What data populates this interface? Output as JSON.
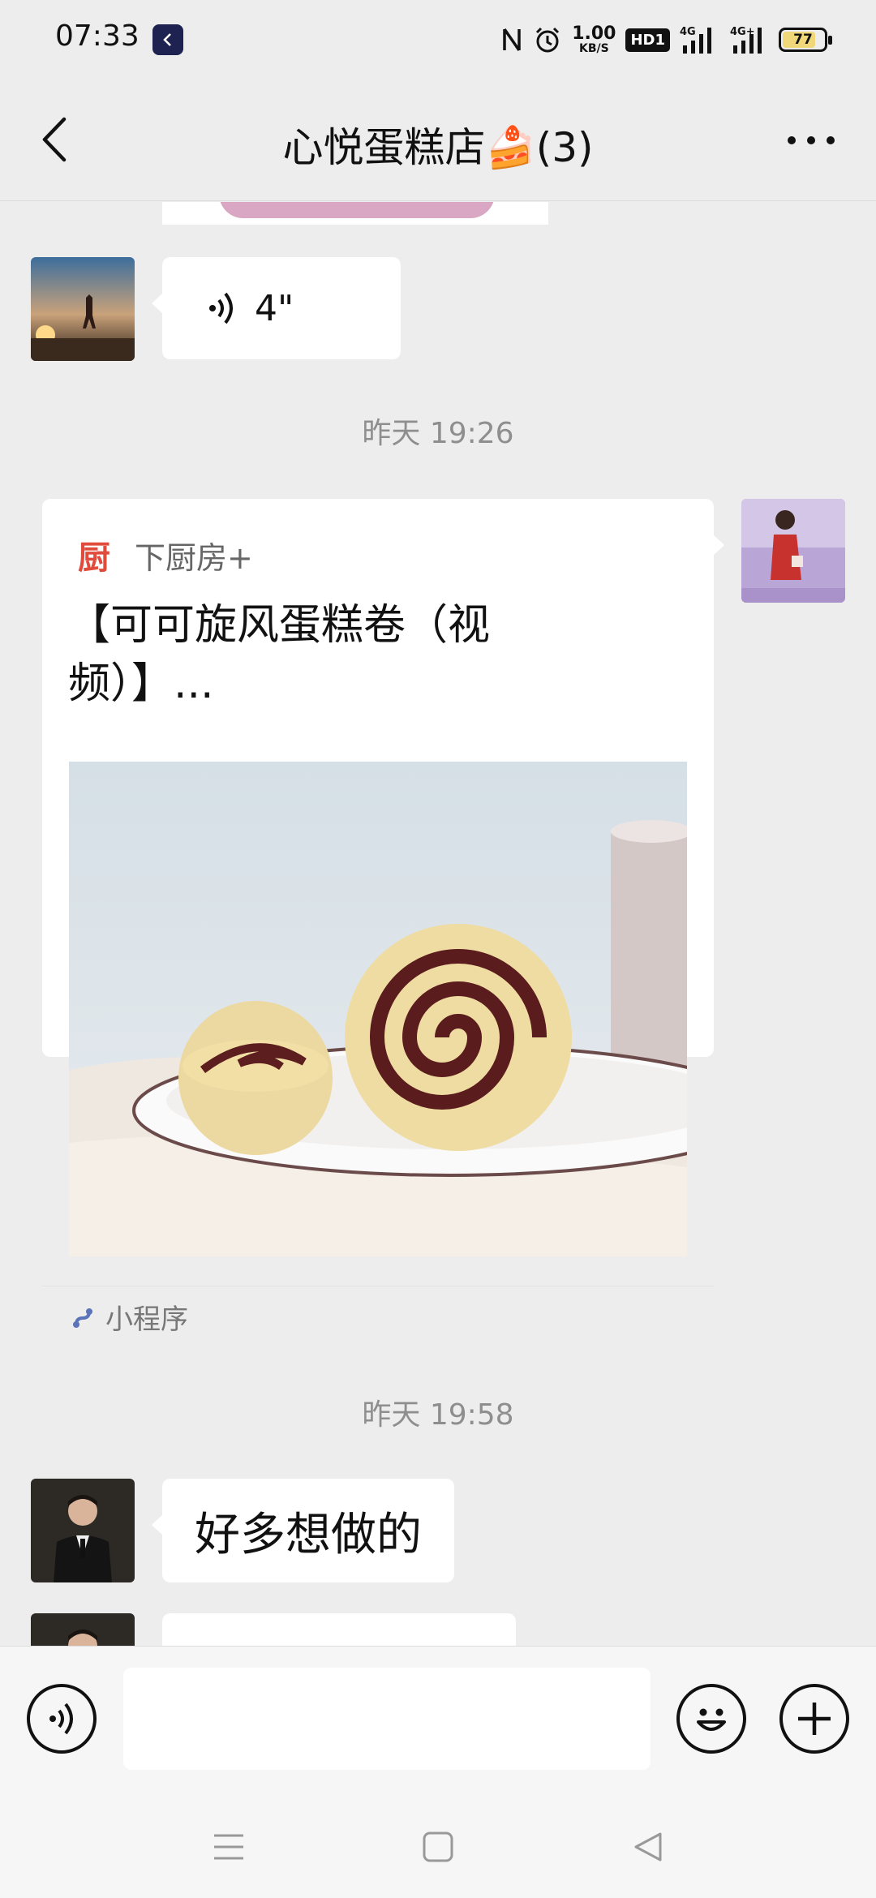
{
  "status_bar": {
    "time": "07:33",
    "net_speed_value": "1.00",
    "net_speed_unit": "KB/S",
    "hd_label": "HD1",
    "network_1": "4G",
    "network_2": "4G+",
    "battery": "77"
  },
  "header": {
    "title": "心悦蛋糕店🍰(3)"
  },
  "messages": {
    "voice": {
      "duration": "4\""
    },
    "timestamp_1": "昨天 19:26",
    "card": {
      "source_logo": "厨",
      "source_name": "下厨房+",
      "title": "【可可旋风蛋糕卷（视频）】...",
      "footer_label": "小程序"
    },
    "timestamp_2": "昨天 19:58",
    "text_message": "好多想做的"
  },
  "input_bar": {
    "placeholder": ""
  },
  "colors": {
    "background": "#ededed",
    "bubble": "#ffffff",
    "timestamp": "#8e8e8e",
    "brand_red": "#e04b3c"
  }
}
